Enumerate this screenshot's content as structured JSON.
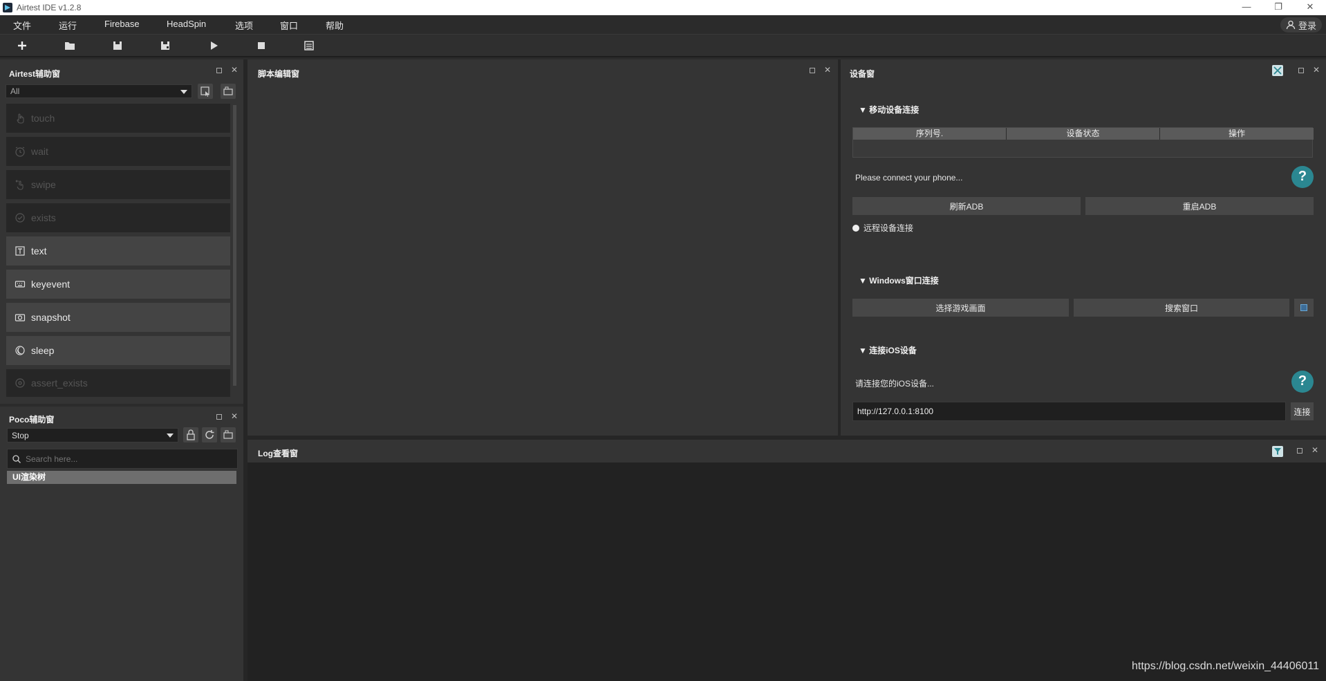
{
  "window": {
    "title": "Airtest IDE v1.2.8"
  },
  "menu": {
    "items": [
      "文件",
      "运行",
      "Firebase",
      "HeadSpin",
      "选项",
      "窗口",
      "帮助"
    ],
    "login": "登录"
  },
  "airtest_panel": {
    "title": "Airtest辅助窗",
    "filter_value": "All",
    "items": [
      {
        "label": "touch",
        "enabled": false
      },
      {
        "label": "wait",
        "enabled": false
      },
      {
        "label": "swipe",
        "enabled": false
      },
      {
        "label": "exists",
        "enabled": false
      },
      {
        "label": "text",
        "enabled": true
      },
      {
        "label": "keyevent",
        "enabled": true
      },
      {
        "label": "snapshot",
        "enabled": true
      },
      {
        "label": "sleep",
        "enabled": true
      },
      {
        "label": "assert_exists",
        "enabled": false
      }
    ]
  },
  "poco_panel": {
    "title": "Poco辅助窗",
    "mode_value": "Stop",
    "search_placeholder": "Search here...",
    "tree_root": "UI渲染树"
  },
  "script_panel": {
    "title": "脚本编辑窗"
  },
  "device_panel": {
    "title": "设备窗",
    "mobile_section": "移动设备连接",
    "table_headers": [
      "序列号.",
      "设备状态",
      "操作"
    ],
    "connect_hint": "Please connect your phone...",
    "refresh_adb": "刷新ADB",
    "restart_adb": "重启ADB",
    "remote_connect": "远程设备连接",
    "windows_section": "Windows窗口连接",
    "select_game": "选择游戏画面",
    "search_window": "搜索窗口",
    "ios_section": "连接iOS设备",
    "ios_hint": "请连接您的iOS设备...",
    "ios_url": "http://127.0.0.1:8100",
    "connect_button": "连接"
  },
  "log_panel": {
    "title": "Log查看窗"
  },
  "watermark": "https://blog.csdn.net/weixin_44406011",
  "colors": {
    "accent": "#2b8791",
    "panel_bg": "#343434",
    "dark_bg": "#222222"
  }
}
